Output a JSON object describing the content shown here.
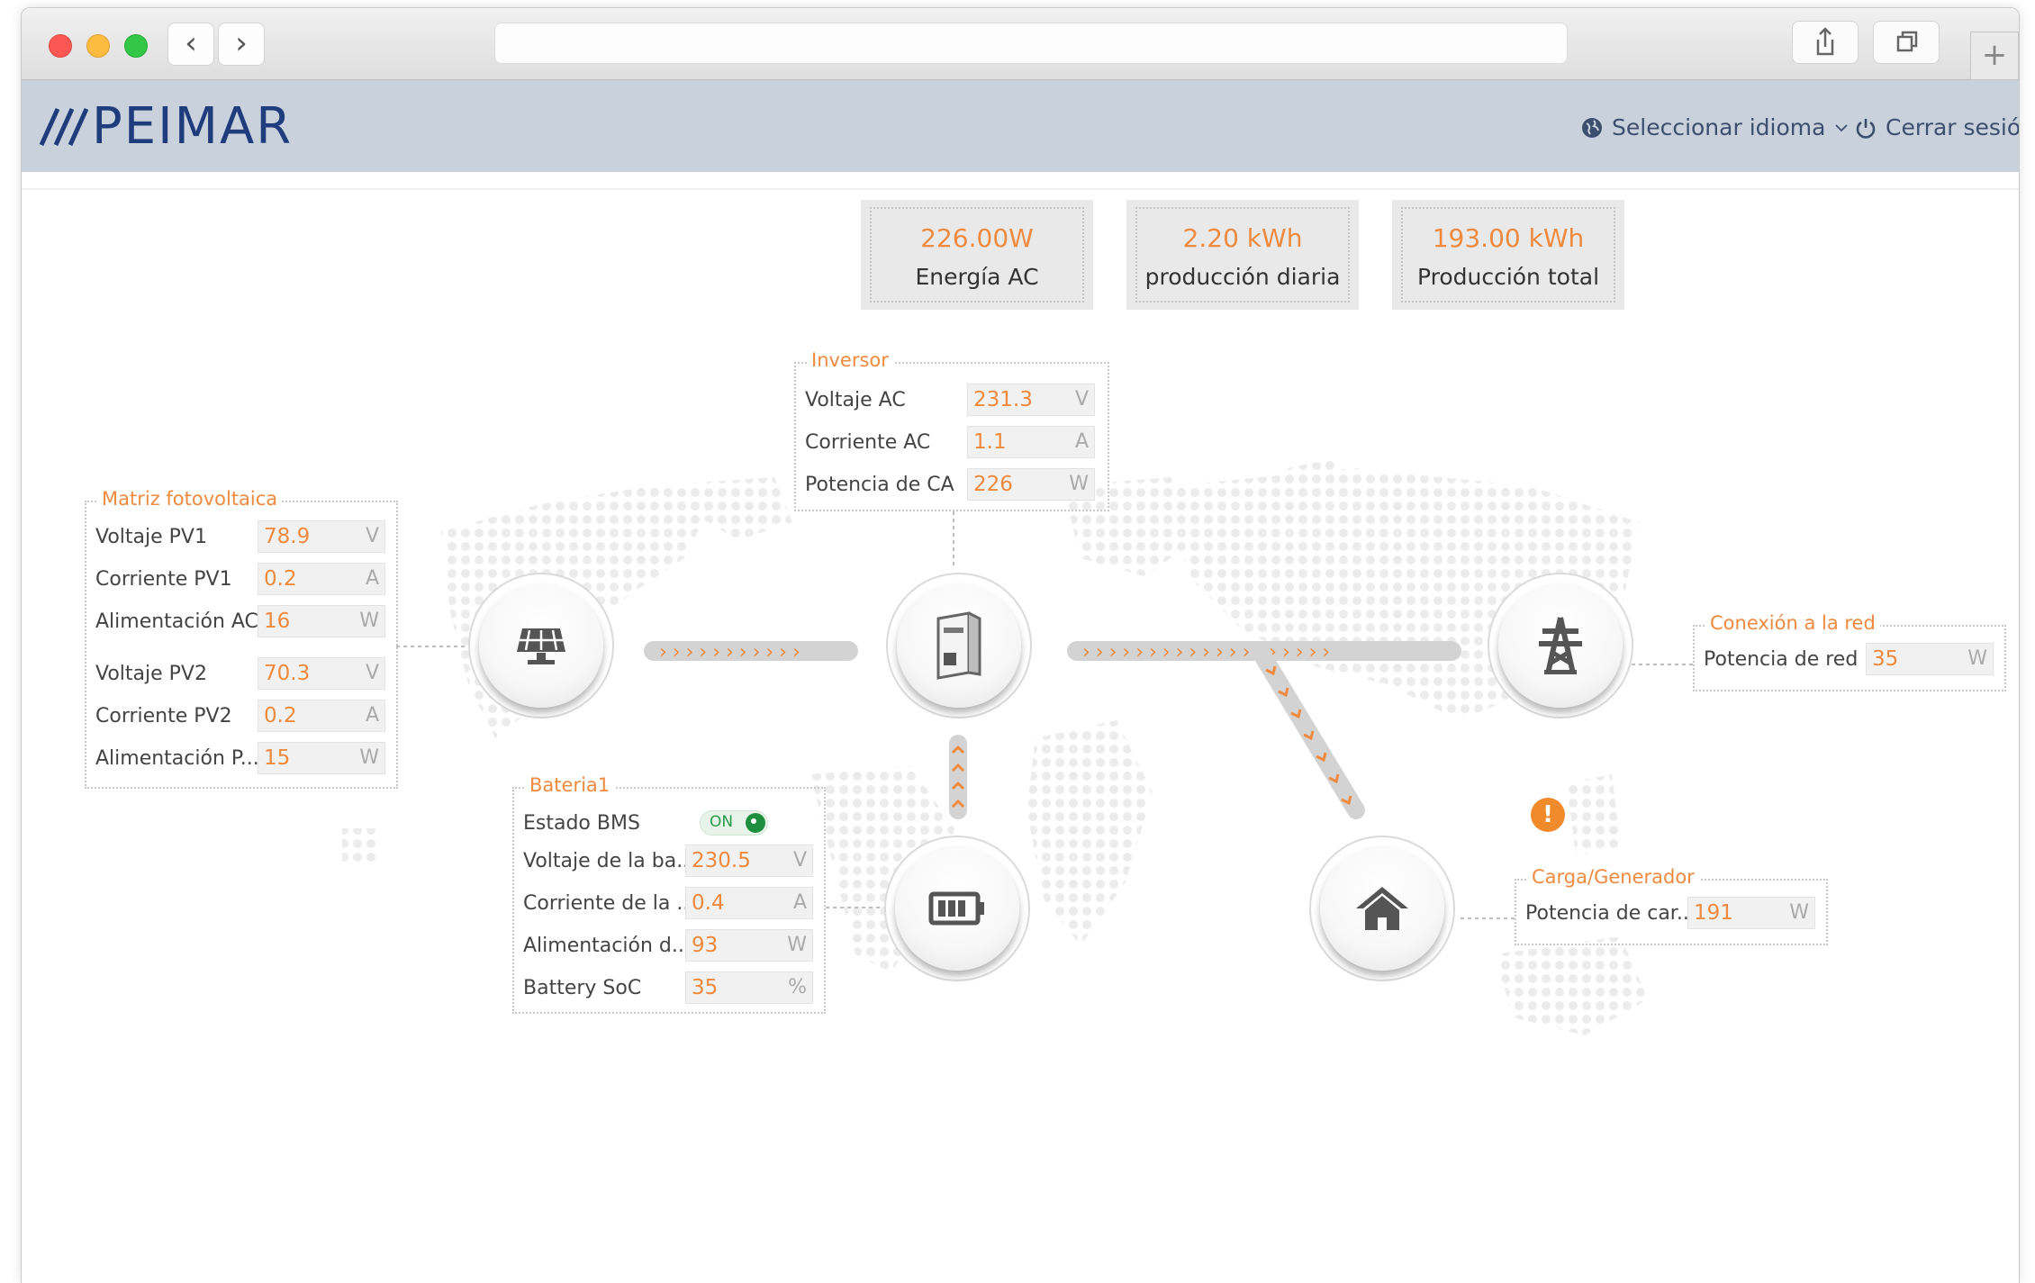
{
  "browser": {
    "back": "‹",
    "forward": "›",
    "plus": "+"
  },
  "header": {
    "logo": "PEIMAR",
    "language_label": "Seleccionar idioma",
    "logout_label": "Cerrar sesión"
  },
  "stats": [
    {
      "value": "226.00W",
      "label": "Energía AC"
    },
    {
      "value": "2.20 kWh",
      "label": "producción diaria"
    },
    {
      "value": "193.00 kWh",
      "label": "Producción total"
    }
  ],
  "inverter": {
    "title": "Inversor",
    "rows": [
      {
        "label": "Voltaje AC",
        "value": "231.3",
        "unit": "V"
      },
      {
        "label": "Corriente AC",
        "value": "1.1",
        "unit": "A"
      },
      {
        "label": "Potencia de CA",
        "value": "226",
        "unit": "W"
      }
    ]
  },
  "pv": {
    "title": "Matriz fotovoltaica",
    "rows": [
      {
        "label": "Voltaje PV1",
        "value": "78.9",
        "unit": "V"
      },
      {
        "label": "Corriente PV1",
        "value": "0.2",
        "unit": "A"
      },
      {
        "label": "Alimentación AC",
        "value": "16",
        "unit": "W"
      },
      {
        "label": "Voltaje PV2",
        "value": "70.3",
        "unit": "V"
      },
      {
        "label": "Corriente PV2",
        "value": "0.2",
        "unit": "A"
      },
      {
        "label": "Alimentación P...",
        "value": "15",
        "unit": "W"
      }
    ]
  },
  "battery": {
    "title": "Bateria1",
    "bms_label": "Estado BMS",
    "bms_state": "ON",
    "rows": [
      {
        "label": "Voltaje de la ba...",
        "value": "230.5",
        "unit": "V"
      },
      {
        "label": "Corriente de la ...",
        "value": "0.4",
        "unit": "A"
      },
      {
        "label": "Alimentación d...",
        "value": "93",
        "unit": "W"
      },
      {
        "label": "Battery SoC",
        "value": "35",
        "unit": "%"
      }
    ]
  },
  "grid": {
    "title": "Conexión a la red",
    "rows": [
      {
        "label": "Potencia de red",
        "value": "35",
        "unit": "W"
      }
    ]
  },
  "load": {
    "title": "Carga/Generador",
    "rows": [
      {
        "label": "Potencia de car...",
        "value": "191",
        "unit": "W"
      }
    ]
  },
  "warning": {
    "symbol": "!"
  },
  "colors": {
    "accent": "#ef8a3f",
    "brand": "#1f3c7c",
    "header_bg": "#c9d1dd"
  }
}
